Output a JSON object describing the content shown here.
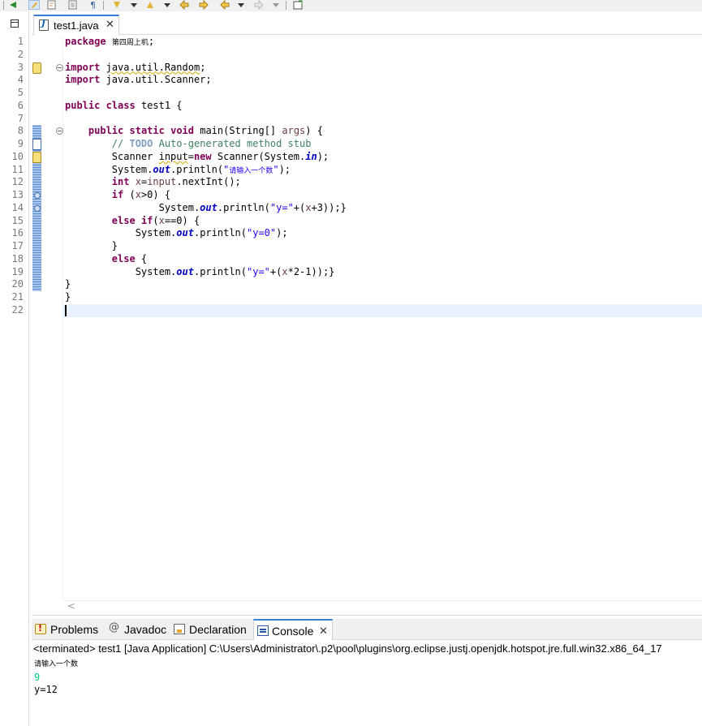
{
  "editor": {
    "tab_label": "test1.java",
    "tab_close": "✕",
    "code_lines": [
      {
        "n": "1",
        "parts": [
          {
            "c": "kw",
            "t": "package"
          },
          {
            "c": "",
            "t": " "
          },
          {
            "c": "cjk",
            "t": "第四周上机"
          },
          {
            "c": "",
            "t": ";"
          }
        ]
      },
      {
        "n": "2",
        "parts": []
      },
      {
        "n": "3",
        "parts": [
          {
            "c": "kw",
            "t": "import"
          },
          {
            "c": "",
            "t": " "
          },
          {
            "c": "warn-ul",
            "t": "java.util.Random"
          },
          {
            "c": "",
            "t": ";"
          }
        ]
      },
      {
        "n": "4",
        "parts": [
          {
            "c": "kw",
            "t": "import"
          },
          {
            "c": "",
            "t": " java.util.Scanner;"
          }
        ]
      },
      {
        "n": "5",
        "parts": []
      },
      {
        "n": "6",
        "parts": [
          {
            "c": "kw",
            "t": "public"
          },
          {
            "c": "",
            "t": " "
          },
          {
            "c": "kw",
            "t": "class"
          },
          {
            "c": "",
            "t": " test1 {"
          }
        ]
      },
      {
        "n": "7",
        "parts": []
      },
      {
        "n": "8",
        "parts": [
          {
            "c": "",
            "t": "    "
          },
          {
            "c": "kw",
            "t": "public"
          },
          {
            "c": "",
            "t": " "
          },
          {
            "c": "kw",
            "t": "static"
          },
          {
            "c": "",
            "t": " "
          },
          {
            "c": "kw",
            "t": "void"
          },
          {
            "c": "",
            "t": " main(String[] "
          },
          {
            "c": "var",
            "t": "args"
          },
          {
            "c": "",
            "t": ") {"
          }
        ]
      },
      {
        "n": "9",
        "parts": [
          {
            "c": "",
            "t": "        "
          },
          {
            "c": "cm",
            "t": "// "
          },
          {
            "c": "todo",
            "t": "TODO"
          },
          {
            "c": "cm",
            "t": " Auto-generated method stub"
          }
        ]
      },
      {
        "n": "10",
        "parts": [
          {
            "c": "",
            "t": "        Scanner "
          },
          {
            "c": "warn-ul",
            "t": "input"
          },
          {
            "c": "",
            "t": "="
          },
          {
            "c": "kw",
            "t": "new"
          },
          {
            "c": "",
            "t": " Scanner(System."
          },
          {
            "c": "fld",
            "t": "in"
          },
          {
            "c": "",
            "t": ");"
          }
        ]
      },
      {
        "n": "11",
        "parts": [
          {
            "c": "",
            "t": "        System."
          },
          {
            "c": "fld",
            "t": "out"
          },
          {
            "c": "",
            "t": ".println("
          },
          {
            "c": "str",
            "t": "\""
          },
          {
            "c": "str cjk",
            "t": "请输入一个数"
          },
          {
            "c": "str",
            "t": "\""
          },
          {
            "c": "",
            "t": ");"
          }
        ]
      },
      {
        "n": "12",
        "parts": [
          {
            "c": "",
            "t": "        "
          },
          {
            "c": "kw",
            "t": "int"
          },
          {
            "c": "",
            "t": " "
          },
          {
            "c": "var",
            "t": "x"
          },
          {
            "c": "",
            "t": "="
          },
          {
            "c": "var",
            "t": "input"
          },
          {
            "c": "",
            "t": ".nextInt();"
          }
        ]
      },
      {
        "n": "13",
        "parts": [
          {
            "c": "",
            "t": "        "
          },
          {
            "c": "kw",
            "t": "if"
          },
          {
            "c": "",
            "t": " ("
          },
          {
            "c": "var",
            "t": "x"
          },
          {
            "c": "",
            "t": ">0) {"
          }
        ]
      },
      {
        "n": "14",
        "parts": [
          {
            "c": "",
            "t": "                System."
          },
          {
            "c": "fld",
            "t": "out"
          },
          {
            "c": "",
            "t": ".println("
          },
          {
            "c": "str",
            "t": "\"y=\""
          },
          {
            "c": "",
            "t": "+("
          },
          {
            "c": "var",
            "t": "x"
          },
          {
            "c": "",
            "t": "+3));}"
          }
        ]
      },
      {
        "n": "15",
        "parts": [
          {
            "c": "",
            "t": "        "
          },
          {
            "c": "kw",
            "t": "else"
          },
          {
            "c": "",
            "t": " "
          },
          {
            "c": "kw",
            "t": "if"
          },
          {
            "c": "",
            "t": "("
          },
          {
            "c": "var",
            "t": "x"
          },
          {
            "c": "",
            "t": "==0) {"
          }
        ]
      },
      {
        "n": "16",
        "parts": [
          {
            "c": "",
            "t": "            System."
          },
          {
            "c": "fld",
            "t": "out"
          },
          {
            "c": "",
            "t": ".println("
          },
          {
            "c": "str",
            "t": "\"y=0\""
          },
          {
            "c": "",
            "t": ");"
          }
        ]
      },
      {
        "n": "17",
        "parts": [
          {
            "c": "",
            "t": "        }"
          }
        ]
      },
      {
        "n": "18",
        "parts": [
          {
            "c": "",
            "t": "        "
          },
          {
            "c": "kw",
            "t": "else"
          },
          {
            "c": "",
            "t": " {"
          }
        ]
      },
      {
        "n": "19",
        "parts": [
          {
            "c": "",
            "t": "            System."
          },
          {
            "c": "fld",
            "t": "out"
          },
          {
            "c": "",
            "t": ".println("
          },
          {
            "c": "str",
            "t": "\"y=\""
          },
          {
            "c": "",
            "t": "+("
          },
          {
            "c": "var",
            "t": "x"
          },
          {
            "c": "",
            "t": "*2-1));}"
          }
        ]
      },
      {
        "n": "20",
        "parts": [
          {
            "c": "",
            "t": "}"
          }
        ]
      },
      {
        "n": "21",
        "parts": [
          {
            "c": "",
            "t": "}"
          }
        ]
      },
      {
        "n": "22",
        "parts": []
      }
    ]
  },
  "panel": {
    "tabs": [
      {
        "name": "problems",
        "label": "Problems",
        "icon": "problems-icon"
      },
      {
        "name": "javadoc",
        "label": "Javadoc",
        "icon": "javadoc-icon"
      },
      {
        "name": "declaration",
        "label": "Declaration",
        "icon": "declaration-icon"
      },
      {
        "name": "console",
        "label": "Console",
        "icon": "console-icon"
      }
    ],
    "console_close": "✕",
    "status": "<terminated> test1 [Java Application] C:\\Users\\Administrator\\.p2\\pool\\plugins\\org.eclipse.justj.openjdk.hotspot.jre.full.win32.x86_64_17",
    "output": {
      "prompt": "请输入一个数",
      "user_input": "9",
      "result": "y=12"
    }
  },
  "colors": {
    "keyword": "#7f0055",
    "comment": "#3f7f5f",
    "string": "#2a00ff",
    "console_input": "#00c87d",
    "accent": "#3a7bd5"
  }
}
